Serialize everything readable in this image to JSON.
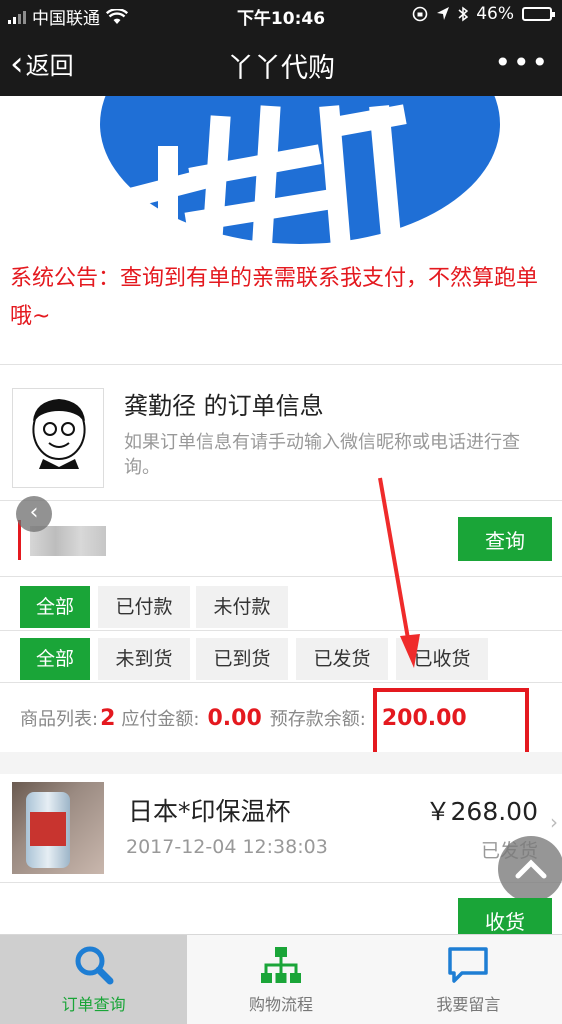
{
  "status_bar": {
    "carrier": "中国联通",
    "time": "下午10:46",
    "battery": "46%",
    "battery_level": 0.46
  },
  "nav": {
    "back_label": "返回",
    "title": "丫丫代购"
  },
  "notice": "系统公告：查询到有单的亲需联系我支付，不然算跑单哦~",
  "order": {
    "title": "龚勤径 的订单信息",
    "hint": "如果订单信息有请手动输入微信昵称或电话进行查询。",
    "query_label": "查询"
  },
  "filters_row1": [
    "全部",
    "已付款",
    "未付款"
  ],
  "filters_row2": [
    "全部",
    "未到货",
    "已到货",
    "已发货",
    "已收货"
  ],
  "summary": {
    "items_label": "商品列表:",
    "items_count": "2",
    "due_label": "应付金额:",
    "due_amount": "0.00",
    "deposit_label": "预存款余额:",
    "deposit_amount": "200.00"
  },
  "product": {
    "name": "日本*印保温杯",
    "price": "￥268.00",
    "time": "2017-12-04 12:38:03",
    "status": "已发货",
    "receive_label": "收货"
  },
  "tabs": [
    {
      "label": "订单查询",
      "icon": "search-icon",
      "active": true
    },
    {
      "label": "购物流程",
      "icon": "sitemap-icon",
      "active": false
    },
    {
      "label": "我要留言",
      "icon": "chat-icon",
      "active": false
    }
  ],
  "colors": {
    "accent": "#1aa538",
    "alert": "#e4191f",
    "bar": "#1a1a1a",
    "tab_icon": "#1e7ed4"
  }
}
